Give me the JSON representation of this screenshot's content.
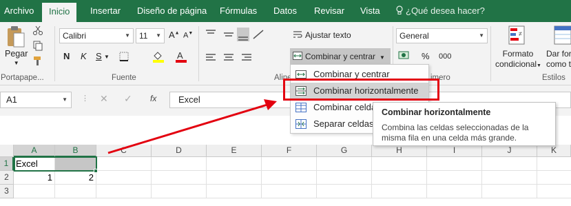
{
  "tabs": [
    {
      "label": "Archivo",
      "active": false
    },
    {
      "label": "Inicio",
      "active": true
    },
    {
      "label": "Insertar",
      "active": false
    },
    {
      "label": "Diseño de página",
      "active": false
    },
    {
      "label": "Fórmulas",
      "active": false
    },
    {
      "label": "Datos",
      "active": false
    },
    {
      "label": "Revisar",
      "active": false
    },
    {
      "label": "Vista",
      "active": false
    }
  ],
  "tell_me": "¿Qué desea hacer?",
  "ribbon": {
    "clipboard": {
      "paste_label": "Pegar",
      "group_label": "Portapape..."
    },
    "font": {
      "font_name": "Calibri",
      "font_size": "11",
      "bold": "N",
      "italic": "K",
      "underline": "S",
      "group_label": "Fuente"
    },
    "alignment": {
      "wrap_text": "Ajustar texto",
      "merge_center": "Combinar y centrar",
      "group_label": "Aline"
    },
    "number": {
      "format": "General",
      "percent": "%",
      "thousands": "000",
      "group_label": "imero"
    },
    "styles": {
      "conditional_line1": "Formato",
      "conditional_line2": "condicional",
      "table_line1": "Dar for",
      "table_line2": "como t",
      "group_label": "Estilos"
    }
  },
  "formula_bar": {
    "name_box": "A1",
    "cancel": "✕",
    "enter": "✓",
    "fx": "fx",
    "content": "Excel"
  },
  "grid": {
    "columns": [
      "A",
      "B",
      "C",
      "D",
      "E",
      "F",
      "G",
      "H",
      "I",
      "J",
      "K"
    ],
    "rows": [
      {
        "num": "1",
        "A": "Excel",
        "B": ""
      },
      {
        "num": "2",
        "A": "1",
        "B": "2"
      },
      {
        "num": "3",
        "A": "",
        "B": ""
      }
    ]
  },
  "dropdown": {
    "items": [
      {
        "label": "Combinar y centrar",
        "icon": "merge-center-icon"
      },
      {
        "label": "Combinar horizontalmente",
        "icon": "merge-across-icon"
      },
      {
        "label": "Combinar celdas",
        "icon": "merge-cells-icon"
      },
      {
        "label": "Separar celdas",
        "icon": "unmerge-cells-icon"
      }
    ]
  },
  "tooltip": {
    "title": "Combinar horizontalmente",
    "body": "Combina las celdas seleccionadas de la misma fila en una celda más grande."
  },
  "colors": {
    "accent": "#217346",
    "highlight": "#e3000f",
    "arrow": "#e3000f"
  }
}
